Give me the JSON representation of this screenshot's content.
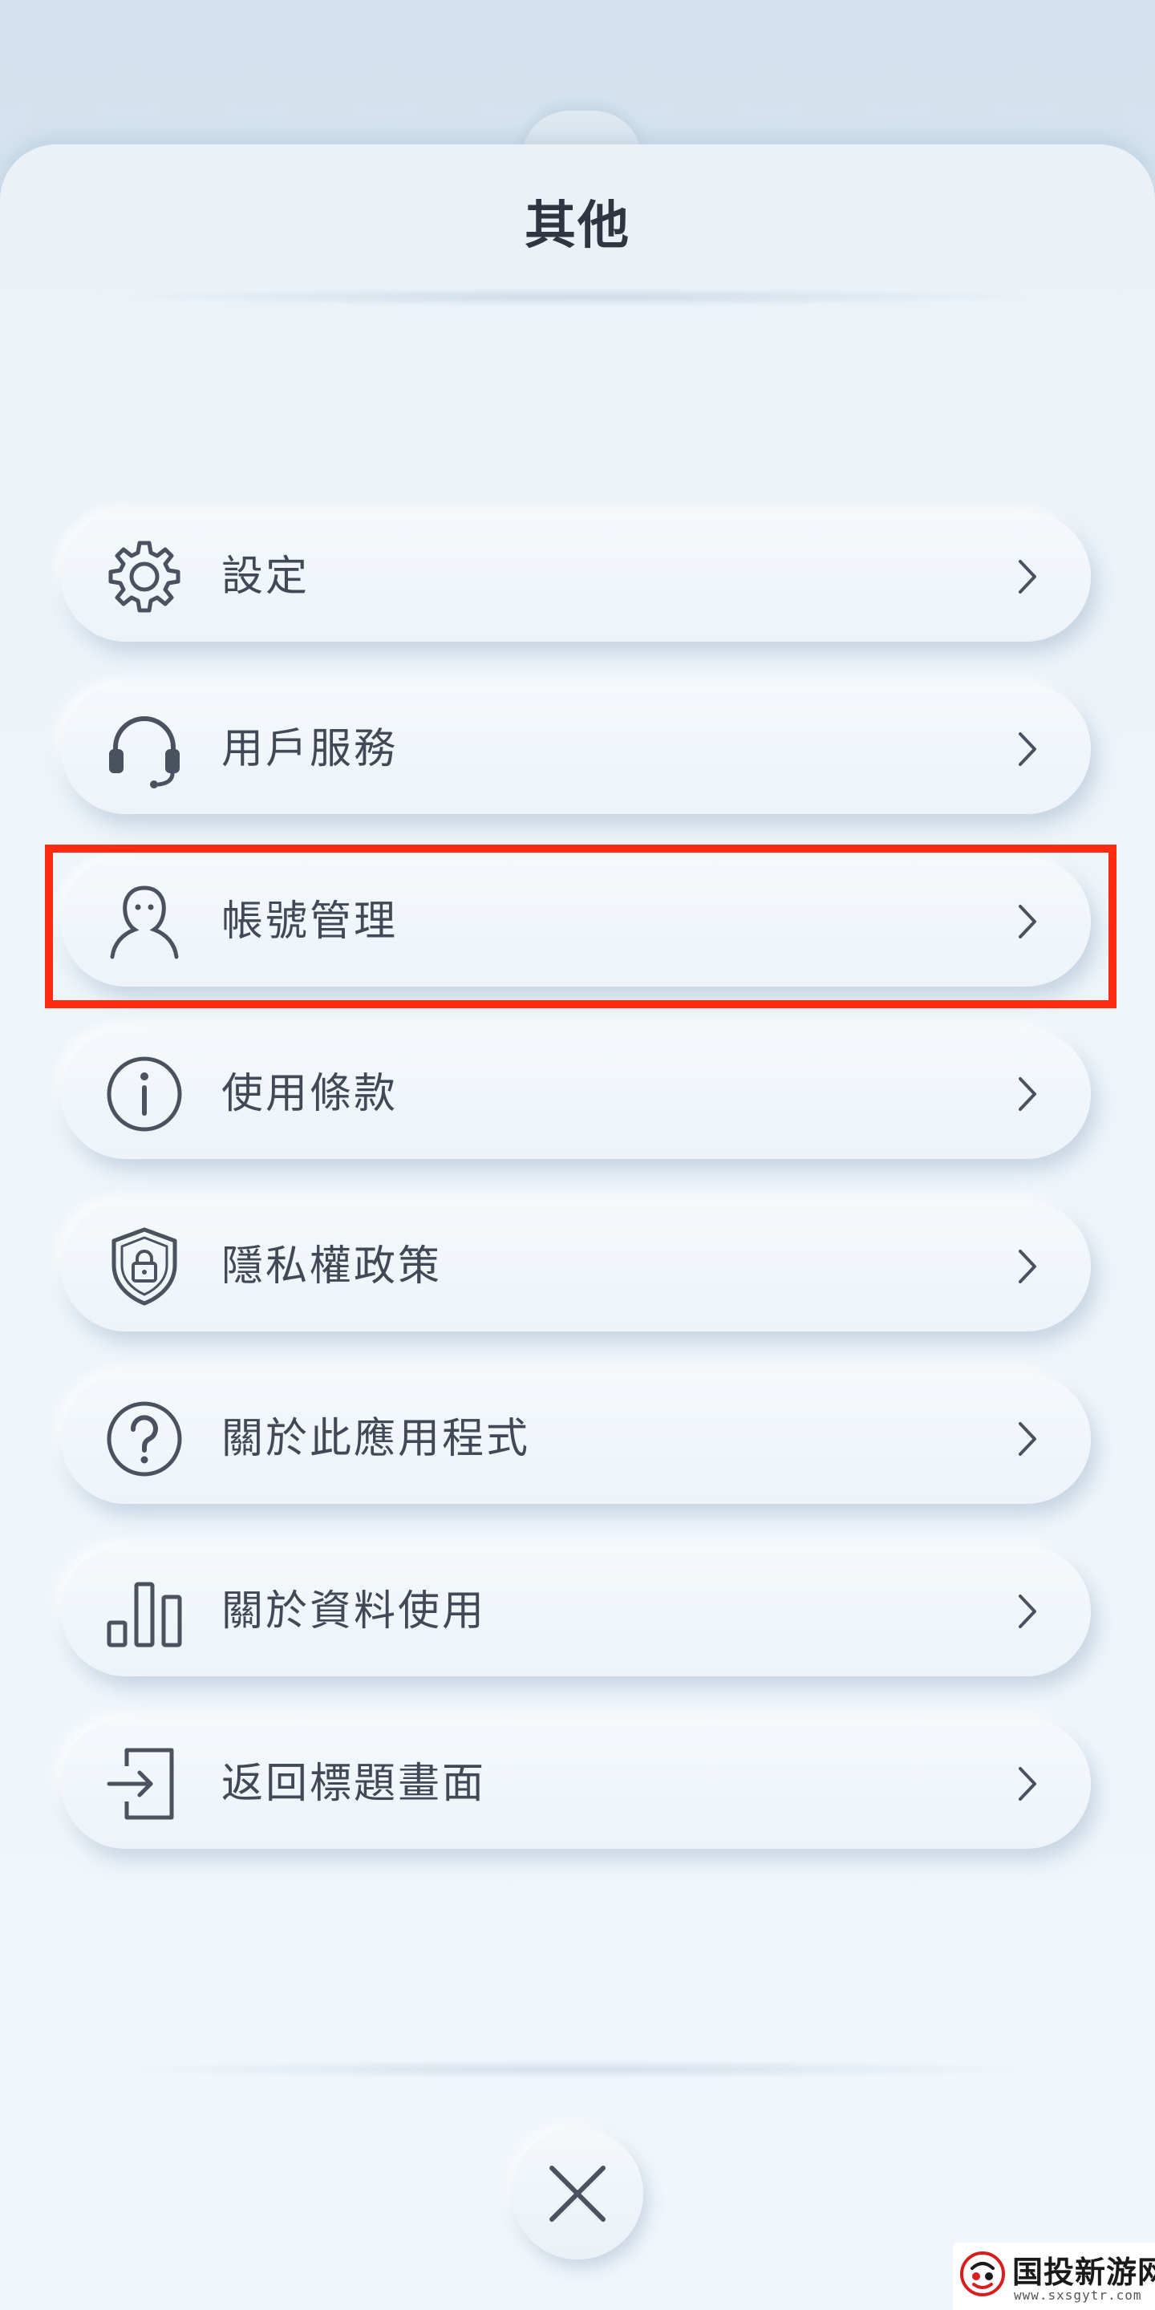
{
  "header": {
    "title": "其他"
  },
  "menu": {
    "items": [
      {
        "label": "設定",
        "icon": "gear-icon"
      },
      {
        "label": "用戶服務",
        "icon": "headset-icon"
      },
      {
        "label": "帳號管理",
        "icon": "user-icon"
      },
      {
        "label": "使用條款",
        "icon": "info-icon"
      },
      {
        "label": "隱私權政策",
        "icon": "shield-lock-icon"
      },
      {
        "label": "關於此應用程式",
        "icon": "question-icon"
      },
      {
        "label": "關於資料使用",
        "icon": "bar-chart-icon"
      },
      {
        "label": "返回標題畫面",
        "icon": "exit-icon"
      }
    ],
    "highlighted_item": "帳號管理"
  },
  "footer": {
    "close_icon": "close-icon"
  },
  "watermark": {
    "name": "国投新游网",
    "domain": "www.sxsgytr.com"
  },
  "colors": {
    "background": "#d3e2ee",
    "panel": "#eef5fa",
    "text": "#414957",
    "icon": "#4a5260",
    "highlight": "#ff2a12"
  }
}
